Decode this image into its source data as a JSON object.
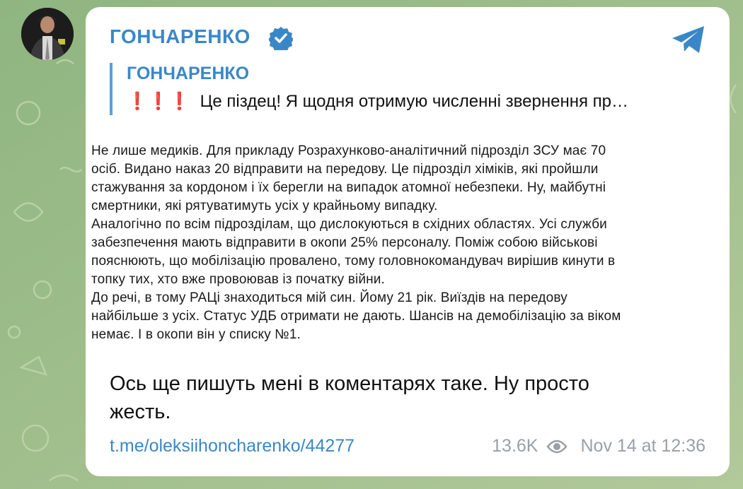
{
  "colors": {
    "accent": "#3a87c8",
    "card": "#ffffff",
    "wallpaper": "#9fbe8e",
    "exclamation": "#e21b23",
    "meta": "#9aa0a6"
  },
  "post": {
    "channel_name": "ГОНЧАРЕНКО",
    "verified_icon": "verified-badge-icon",
    "share_icon": "telegram-plane-icon",
    "reply": {
      "author": "ГОНЧАРЕНКО",
      "exclamations": "❗❗❗",
      "text": "Це піздец! Я щодня отримую численні звернення пр…"
    },
    "screenshot_lines": [
      "Не лише медиків. Для прикладу Розрахунково-аналітичний підрозділ ЗСУ має 70",
      "осіб. Видано наказ 20 відправити на передову. Це підрозділ хіміків, які пройшли",
      "стажування за кордоном і їх берегли на випадок атомної небезпеки. Ну, майбутні",
      "смертники, які рятуватимуть усіх у крайньому випадку.",
      "Аналогічно по всім підрозділам, що дислокуються в східних областях. Усі служби",
      "забезпечення мають відправити в окопи 25% персоналу. Поміж собою військові",
      "пояснюють, що мобілізацію провалено, тому головнокомандувач вирішив кинути в",
      "топку тих, хто вже провоював із початку війни.",
      "До речі, в тому РАЦі знаходиться мій син. Йому 21 рік. Виїздів на передову",
      "найбільше з усіх. Статус УДБ отримати не дають. Шансів на демобілізацію за віком",
      "немає. І в окопи він у списку №1."
    ],
    "caption_lines": [
      "Ось ще пишуть мені в коментарях таке. Ну просто",
      "жесть."
    ],
    "link": "t.me/oleksiihoncharenko/44277",
    "views": "13.6K",
    "views_icon": "eye-icon",
    "date": "Nov 14 at 12:36"
  }
}
